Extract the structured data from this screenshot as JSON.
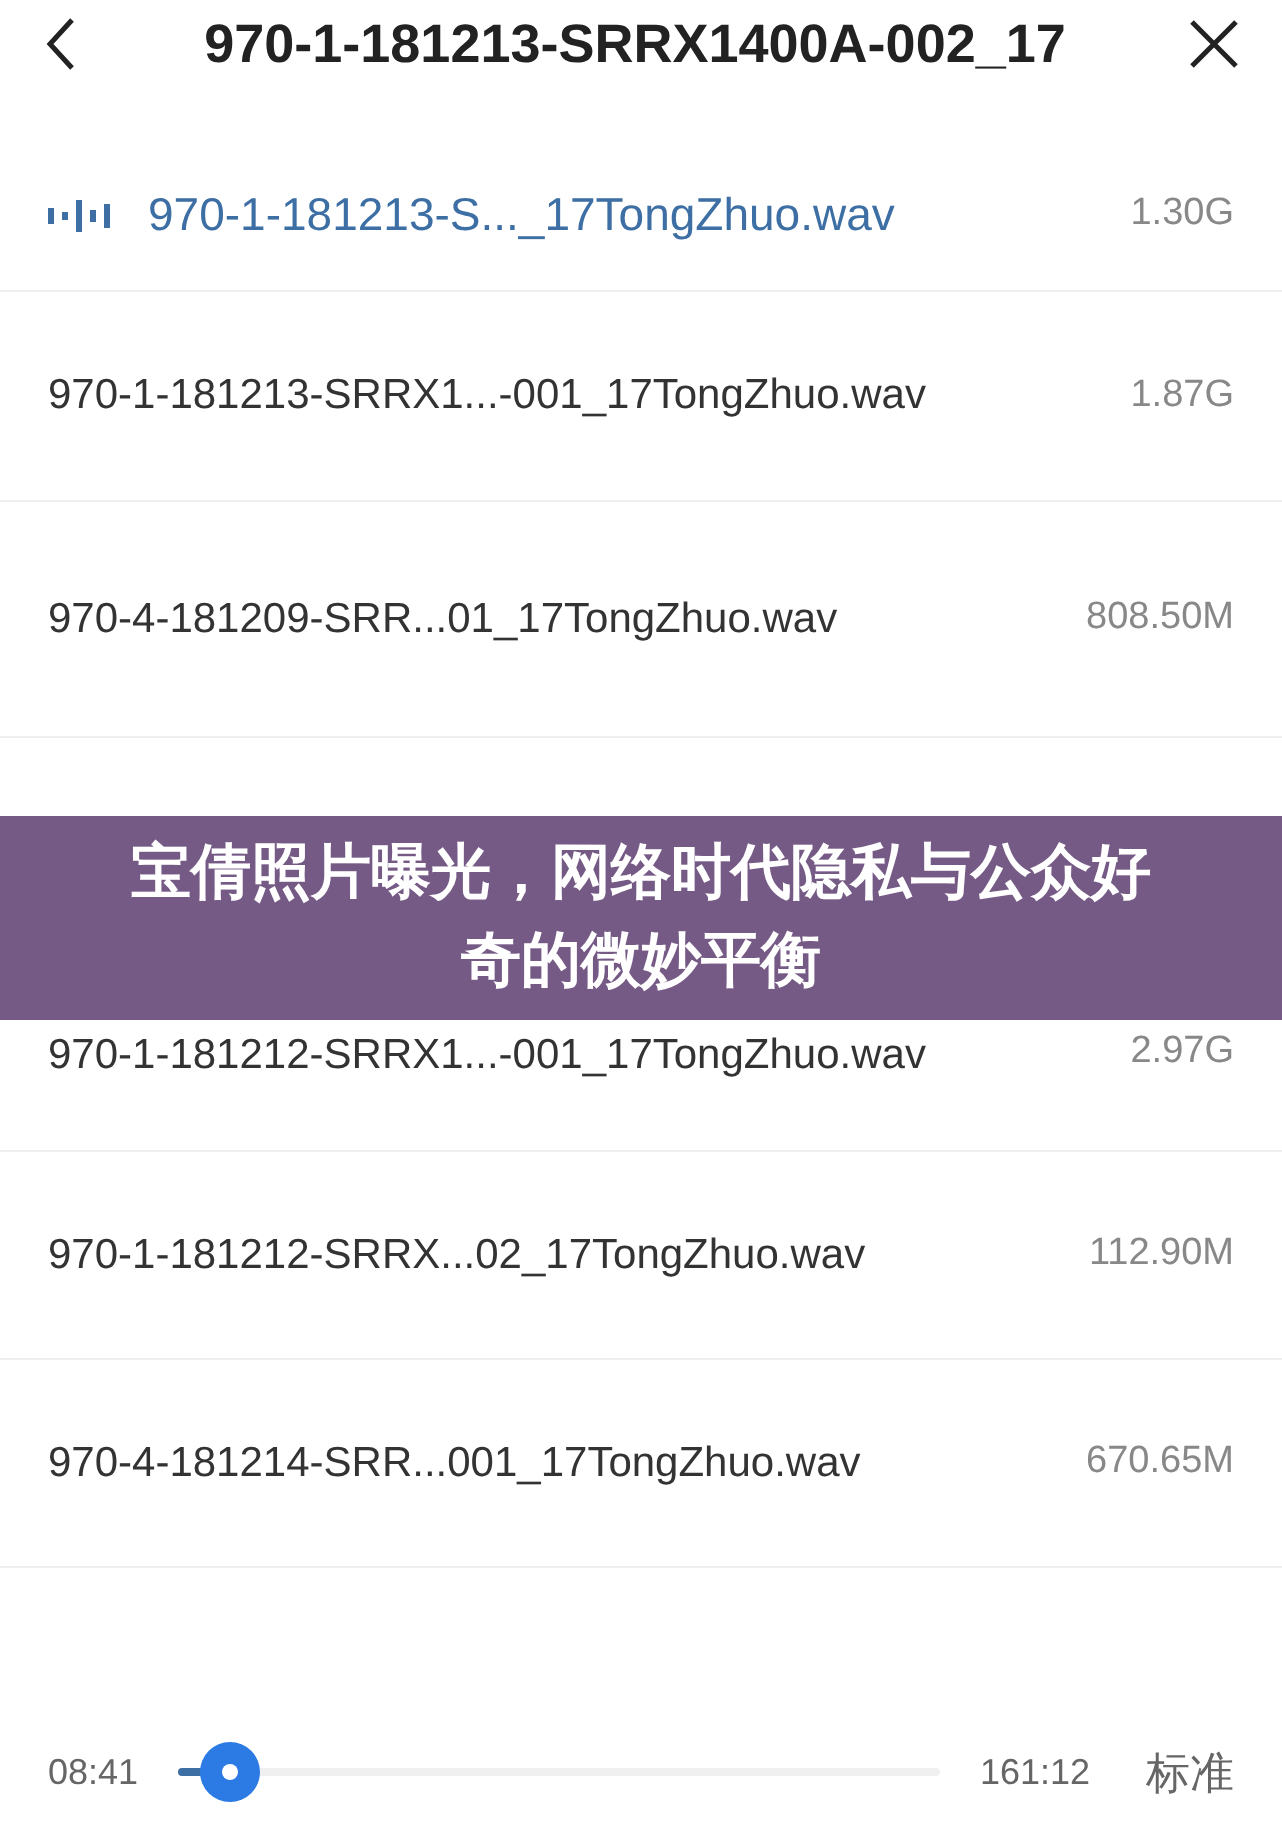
{
  "header": {
    "title": "970-1-181213-SRRX1400A-002_17"
  },
  "files": [
    {
      "name": "970-1-181213-S..._17TongZhuo.wav",
      "size": "1.30G",
      "selected": true
    },
    {
      "name": "970-1-181213-SRRX1...-001_17TongZhuo.wav",
      "size": "1.87G",
      "selected": false
    },
    {
      "name": "970-4-181209-SRR...01_17TongZhuo.wav",
      "size": "808.50M",
      "selected": false
    },
    {
      "name": "970-1-181212-SRRX1...-001_17TongZhuo.wav",
      "size": "2.97G",
      "selected": false
    },
    {
      "name": "970-1-181212-SRRX...02_17TongZhuo.wav",
      "size": "112.90M",
      "selected": false
    },
    {
      "name": "970-4-181214-SRR...001_17TongZhuo.wav",
      "size": "670.65M",
      "selected": false
    }
  ],
  "player": {
    "elapsed": "08:41",
    "level": 0.04,
    "total": "161:12",
    "speed": "标准"
  },
  "banner": {
    "text": "宝倩照片曝光，网络时代隐私与公众好奇的微妙平衡"
  }
}
